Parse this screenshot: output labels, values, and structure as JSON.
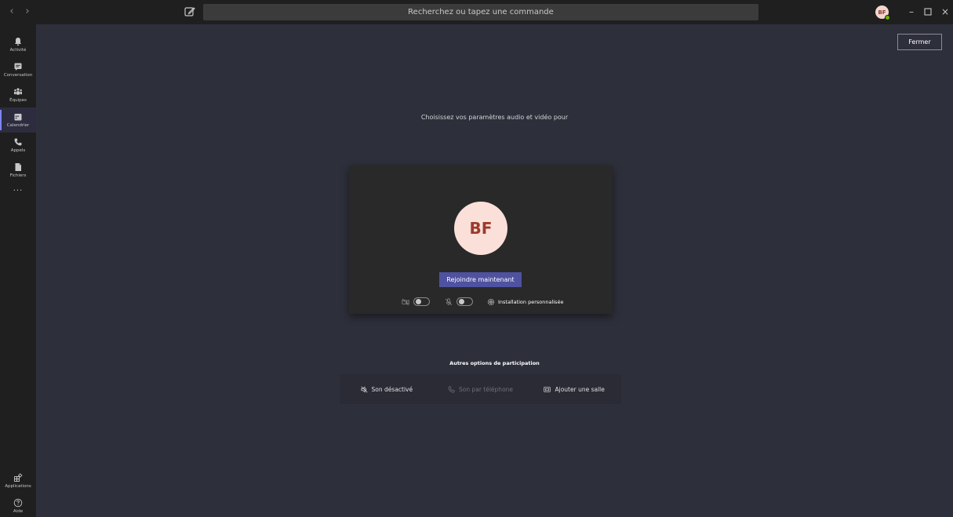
{
  "titlebar": {
    "search_placeholder": "Recherchez ou tapez une commande",
    "avatar_initials": "BF"
  },
  "rail": {
    "items": [
      {
        "label": "Activité",
        "icon": "bell-icon"
      },
      {
        "label": "Conversation",
        "icon": "chat-icon"
      },
      {
        "label": "Équipes",
        "icon": "teams-icon"
      },
      {
        "label": "Calendrier",
        "icon": "calendar-icon",
        "active": true
      },
      {
        "label": "Appels",
        "icon": "phone-icon"
      },
      {
        "label": "Fichiers",
        "icon": "file-icon"
      }
    ],
    "more": "···",
    "bottom": [
      {
        "label": "Applications",
        "icon": "apps-icon"
      },
      {
        "label": "Aide",
        "icon": "help-icon"
      }
    ]
  },
  "main": {
    "close_label": "Fermer",
    "prompt": "Choisissez vos paramètres audio et vidéo pour",
    "avatar_initials": "BF",
    "join_label": "Rejoindre maintenant",
    "custom_setup_label": "Installation personnalisée",
    "other_title": "Autres options de participation",
    "options": [
      {
        "label": "Son désactivé",
        "icon": "speaker-off-icon",
        "enabled": true
      },
      {
        "label": "Son par téléphone",
        "icon": "phone-icon",
        "enabled": false
      },
      {
        "label": "Ajouter une salle",
        "icon": "room-icon",
        "enabled": true
      }
    ]
  },
  "colors": {
    "accent": "#4f52a0",
    "stage": "#2d2f3a",
    "chrome": "#1f1f1f",
    "card": "#292929",
    "avatar_bg": "#fbe0d9",
    "avatar_text": "#9c3a2c"
  }
}
